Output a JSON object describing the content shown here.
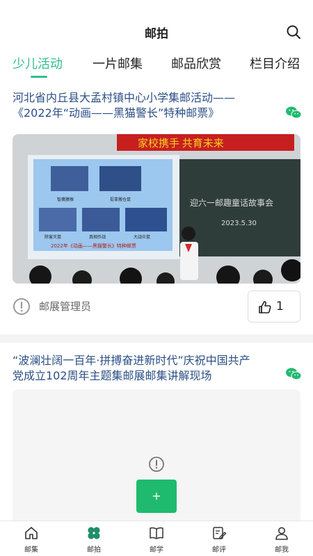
{
  "header": {
    "title": "邮拍",
    "search_icon": "search-icon"
  },
  "tabs": [
    {
      "label": "少儿活动",
      "active": true
    },
    {
      "label": "一片邮集",
      "active": false
    },
    {
      "label": "邮品欣赏",
      "active": false
    },
    {
      "label": "栏目介绍",
      "active": false
    }
  ],
  "colors": {
    "accent": "#2fbf8f",
    "title_blue": "#2b4f86",
    "button_green": "#1fba6e"
  },
  "posts": [
    {
      "title_line1": "河北省内丘县大孟村镇中心小学集邮活动——",
      "title_line2": "《2022年“动画——黑猫警长”特种邮票》",
      "photo": {
        "banner": "家校携手 共育未来",
        "screen_labels": [
          "智擒猿猴",
          "捉拿搬仓鼠",
          "除害灭鼠",
          "真相作战",
          "大战众鼠"
        ],
        "screen_caption": "2022年《动画——黑猫警长》特种邮票",
        "board_text": "迎六一邮趣童话故事会",
        "board_date": "2023.5.30"
      },
      "author": "邮展管理员",
      "likes": "1"
    },
    {
      "title_line1": "“波澜壮阔一百年·拼搏奋进新时代”庆祝中国共产",
      "title_line2": "党成立102周年主题集邮展邮集讲解现场",
      "button_label": "+"
    }
  ],
  "bottom_nav": [
    {
      "label": "邮集",
      "icon": "home-icon"
    },
    {
      "label": "邮拍",
      "icon": "clover-icon",
      "active": true
    },
    {
      "label": "邮学",
      "icon": "book-icon"
    },
    {
      "label": "邮评",
      "icon": "edit-icon"
    },
    {
      "label": "邮我",
      "icon": "user-icon"
    }
  ]
}
